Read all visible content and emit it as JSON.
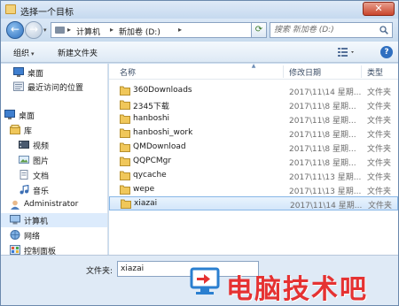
{
  "window": {
    "title": "选择一个目标",
    "close_label": "✕"
  },
  "address": {
    "crumbs": [
      "计算机",
      "新加卷 (D:)"
    ],
    "search_placeholder": "搜索 新加卷 (D:)"
  },
  "toolbar": {
    "organize_label": "组织",
    "new_folder_label": "新建文件夹"
  },
  "nav": {
    "items": [
      {
        "label": "桌面",
        "icon": "desktop-icon"
      },
      {
        "label": "最近访问的位置",
        "icon": "recent-places-icon"
      },
      {
        "label": "桌面",
        "icon": "desktop-icon"
      },
      {
        "label": "库",
        "icon": "library-icon"
      },
      {
        "label": "视频",
        "icon": "video-icon"
      },
      {
        "label": "图片",
        "icon": "pictures-icon"
      },
      {
        "label": "文档",
        "icon": "documents-icon"
      },
      {
        "label": "音乐",
        "icon": "music-icon"
      },
      {
        "label": "Administrator",
        "icon": "user-icon"
      },
      {
        "label": "计算机",
        "icon": "computer-icon"
      },
      {
        "label": "网络",
        "icon": "network-icon"
      },
      {
        "label": "控制面板",
        "icon": "control-panel-icon"
      }
    ]
  },
  "list": {
    "headers": {
      "name": "名称",
      "date": "修改日期",
      "type": "类型"
    },
    "rows": [
      {
        "name": "360Downloads",
        "date": "2017\\11\\14 星期...",
        "type": "文件夹"
      },
      {
        "name": "2345下载",
        "date": "2017\\11\\8 星期...",
        "type": "文件夹"
      },
      {
        "name": "hanboshi",
        "date": "2017\\11\\8 星期...",
        "type": "文件夹"
      },
      {
        "name": "hanboshi_work",
        "date": "2017\\11\\8 星期...",
        "type": "文件夹"
      },
      {
        "name": "QMDownload",
        "date": "2017\\11\\8 星期...",
        "type": "文件夹"
      },
      {
        "name": "QQPCMgr",
        "date": "2017\\11\\8 星期...",
        "type": "文件夹"
      },
      {
        "name": "qycache",
        "date": "2017\\11\\13 星期...",
        "type": "文件夹"
      },
      {
        "name": "wepe",
        "date": "2017\\11\\13 星期...",
        "type": "文件夹"
      },
      {
        "name": "xiazai",
        "date": "2017\\11\\14 星期...",
        "type": "文件夹"
      }
    ]
  },
  "bottom": {
    "filename_label": "文件夹:",
    "filename_value": "xiazai",
    "watermark": "电脑技术吧"
  },
  "colors": {
    "folder": "#f0c75a",
    "selection": "#d3e6fa",
    "watermark": "#e53232"
  }
}
